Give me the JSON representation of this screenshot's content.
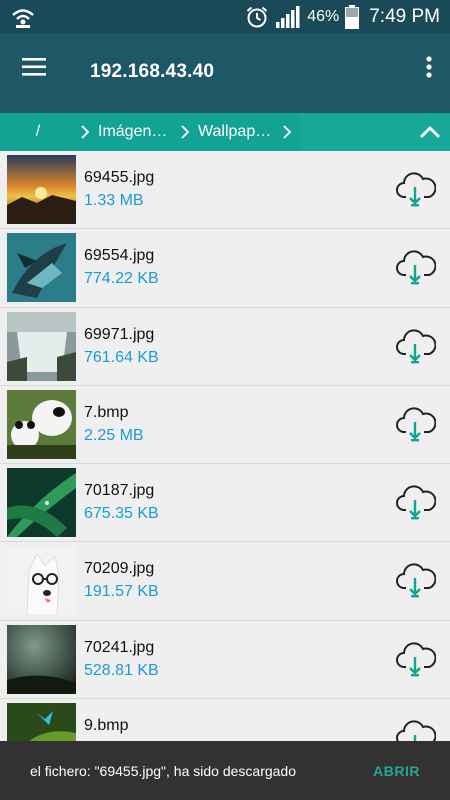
{
  "status_bar": {
    "battery": "46%",
    "time": "7:49 PM",
    "icons": [
      "wifi-hotspot-icon",
      "alarm-icon",
      "signal-icon",
      "battery-icon"
    ]
  },
  "app_bar": {
    "title": "192.168.43.40",
    "icons": [
      "hamburger-menu-icon",
      "more-vert-icon"
    ]
  },
  "breadcrumb": {
    "items": [
      "/",
      "Imágen…",
      "Wallpap…"
    ]
  },
  "files": [
    {
      "name": "69455.jpg",
      "size": "1.33 MB"
    },
    {
      "name": "69554.jpg",
      "size": "774.22 KB"
    },
    {
      "name": "69971.jpg",
      "size": "761.64 KB"
    },
    {
      "name": "7.bmp",
      "size": "2.25 MB"
    },
    {
      "name": "70187.jpg",
      "size": "675.35 KB"
    },
    {
      "name": "70209.jpg",
      "size": "191.57 KB"
    },
    {
      "name": "70241.jpg",
      "size": "528.81 KB"
    },
    {
      "name": "9.bmp",
      "size": ""
    }
  ],
  "snackbar": {
    "message": "el fichero: \"69455.jpg\", ha sido descargado",
    "action": "ABRIR"
  },
  "colors": {
    "status_bar": "#1a4a57",
    "app_bar": "#1e5866",
    "breadcrumb": "#13a394",
    "size_text": "#1a9bd6",
    "download_icon_accent": "#13a394",
    "snackbar_action": "#26a69a"
  }
}
